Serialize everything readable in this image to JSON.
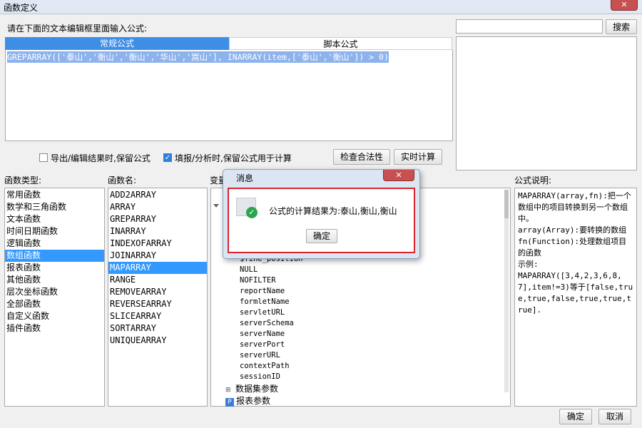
{
  "window": {
    "title": "函数定义",
    "close_glyph": "✕"
  },
  "search": {
    "value": "",
    "button": "搜索"
  },
  "editor": {
    "prompt": "请在下面的文本编辑框里面输入公式:",
    "tabs": [
      "常规公式",
      "脚本公式"
    ],
    "formula": "GREPARRAY(['泰山','衡山','衡山','华山','嵩山'], INARRAY(item,['泰山','衡山']) > 0)"
  },
  "options": {
    "export_keep": {
      "label": "导出/编辑结果时,保留公式",
      "checked": false
    },
    "fill_keep": {
      "label": "填报/分析时,保留公式用于计算",
      "checked": true
    },
    "check_btn": "检查合法性",
    "realtime_btn": "实时计算"
  },
  "function_types": {
    "header": "函数类型:",
    "items": [
      "常用函数",
      "数学和三角函数",
      "文本函数",
      "时间日期函数",
      "逻辑函数",
      "数组函数",
      "报表函数",
      "其他函数",
      "层次坐标函数",
      "全部函数",
      "自定义函数",
      "插件函数"
    ],
    "selected_index": 5
  },
  "function_names": {
    "header": "函数名:",
    "items": [
      "ADD2ARRAY",
      "ARRAY",
      "GREPARRAY",
      "INARRAY",
      "INDEXOFARRAY",
      "JOINARRAY",
      "MAPARRAY",
      "RANGE",
      "REMOVEARRAY",
      "REVERSEARRAY",
      "SLICEARRAY",
      "SORTARRAY",
      "UNIQUEARRAY"
    ],
    "selected_index": 6
  },
  "variables": {
    "header": "变量",
    "items": [
      "$fine_position",
      "NULL",
      "NOFILTER",
      "reportName",
      "formletName",
      "servletURL",
      "serverSchema",
      "serverName",
      "serverPort",
      "serverURL",
      "contextPath",
      "sessionID"
    ],
    "groups": [
      {
        "label": "数据集参数",
        "icon": "dataset-param-icon"
      },
      {
        "label": "报表参数",
        "icon": "report-param-icon",
        "glyph": "P"
      }
    ]
  },
  "description": {
    "header": "公式说明:",
    "lines": [
      "MAPARRAY(array,fn):把一个数组中的项目转换到另一个数组中。",
      "array(Array):要转换的数组",
      "fn(Function):处理数组项目的函数",
      "示例:",
      "MAPARRAY([3,4,2,3,6,8,7],item!=3)等于[false,true,true,false,true,true,true]."
    ]
  },
  "footer": {
    "ok": "确定",
    "cancel": "取消"
  },
  "message_dialog": {
    "title": "消息",
    "text": "公式的计算结果为:泰山,衡山,衡山",
    "ok": "确定",
    "close_glyph": "✕",
    "colors": {
      "success": "#2ea44f",
      "border": "#d9232f"
    }
  }
}
